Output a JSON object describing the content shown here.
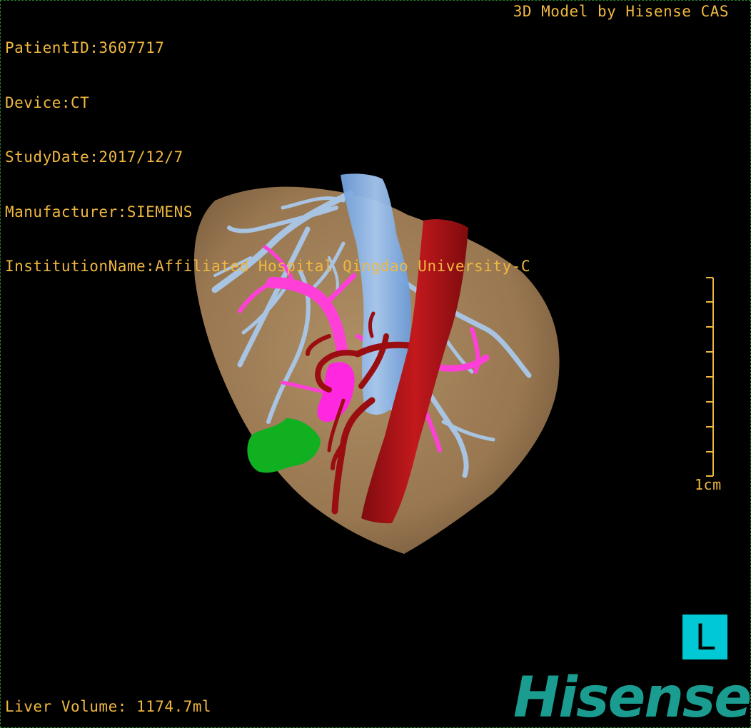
{
  "header": {
    "patient_id": "PatientID:3607717",
    "device": "Device:CT",
    "study_date": "StudyDate:2017/12/7",
    "manufacturer": "Manufacturer:SIEMENS",
    "institution": "InstitutionName:Affiliated Hospital Qingdao University-C",
    "brand_title": "3D Model by Hisense CAS"
  },
  "measurements": {
    "liver_volume": "Liver Volume: 1174.7ml"
  },
  "scale_bar": {
    "label": "1cm"
  },
  "orientation": {
    "label": "L"
  },
  "logo": {
    "text": "Hisense"
  },
  "colors": {
    "overlay_text": "#f0b840",
    "liver": "#a9865c",
    "hepatic_vein": "#a8c4e2",
    "portal_vein": "#ff3fd8",
    "artery": "#a30f12",
    "tumor": "#11b021",
    "orientation_box": "#00c8d4",
    "logo": "#1a9d90"
  }
}
